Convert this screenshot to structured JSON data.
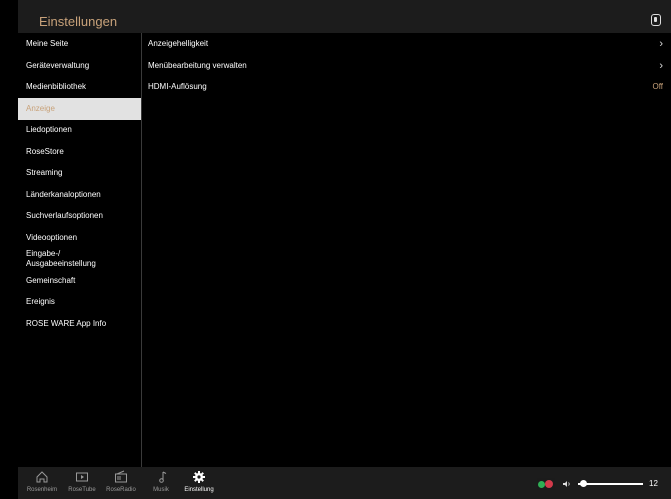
{
  "header": {
    "title": "Einstellungen",
    "icon": "remote-icon"
  },
  "sidebar": {
    "items": [
      {
        "label": "Meine Seite"
      },
      {
        "label": "Geräteverwaltung"
      },
      {
        "label": "Medienbibliothek"
      },
      {
        "label": "Anzeige",
        "active": true
      },
      {
        "label": "Liedoptionen"
      },
      {
        "label": "RoseStore"
      },
      {
        "label": "Streaming"
      },
      {
        "label": "Länderkanaloptionen"
      },
      {
        "label": "Suchverlaufsoptionen"
      },
      {
        "label": "Videooptionen"
      },
      {
        "label": "Eingabe-/\nAusgabeeinstellung"
      },
      {
        "label": "Gemeinschaft"
      },
      {
        "label": "Ereignis"
      },
      {
        "label": "ROSE WARE App Info"
      }
    ]
  },
  "content": {
    "rows": [
      {
        "label": "Anzeigehelligkeit",
        "control": "chevron"
      },
      {
        "label": "Menübearbeitung verwalten",
        "control": "chevron"
      },
      {
        "label": "HDMI-Auflösung",
        "value": "Off"
      }
    ]
  },
  "bottom_nav": {
    "items": [
      {
        "label": "Rosenheim",
        "icon": "home-icon"
      },
      {
        "label": "RoseTube",
        "icon": "video-icon"
      },
      {
        "label": "RoseRadio",
        "icon": "radio-icon"
      },
      {
        "label": "Musik",
        "icon": "music-note-icon"
      },
      {
        "label": "Einstellung",
        "icon": "gear-icon",
        "active": true
      }
    ]
  },
  "player": {
    "volume": 12,
    "volume_fraction": 0.08
  },
  "colors": {
    "accent": "#c8a27a",
    "active_bg": "#e2e2e2",
    "bar_bg": "#1c1c1c"
  }
}
